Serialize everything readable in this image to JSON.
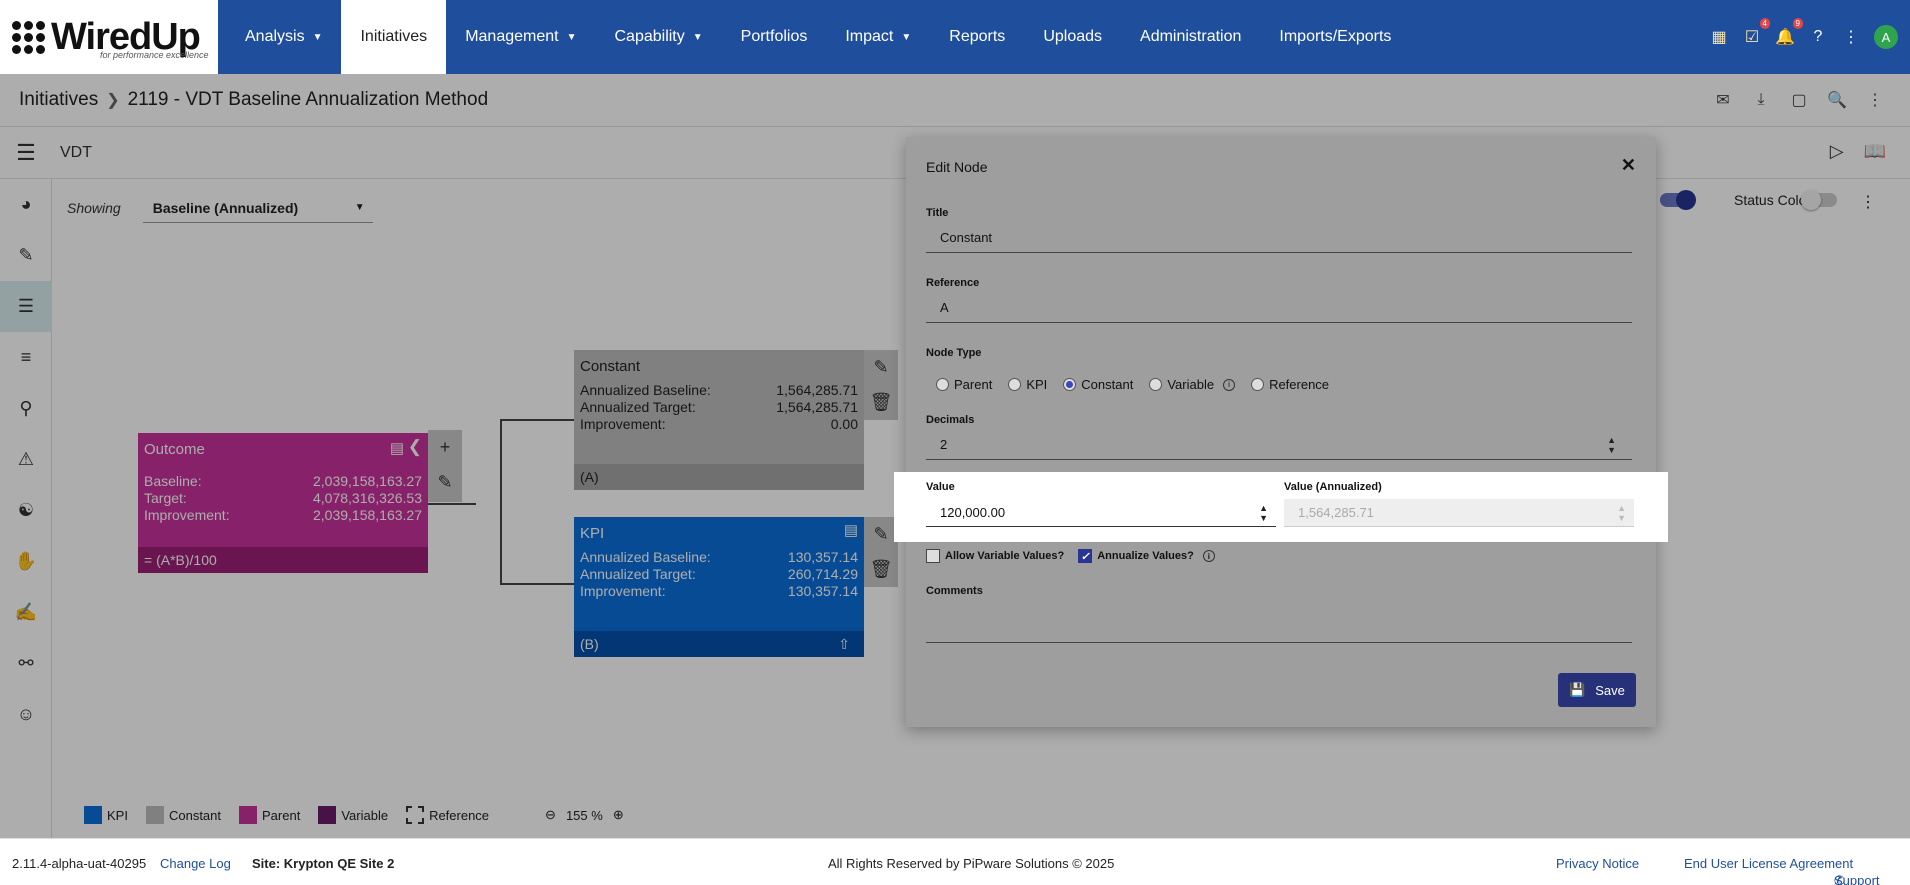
{
  "logo": {
    "name": "WiredUp",
    "tagline": "for performance excellence"
  },
  "nav": {
    "items": [
      {
        "label": "Analysis",
        "caret": true
      },
      {
        "label": "Initiatives",
        "caret": false,
        "active": true
      },
      {
        "label": "Management",
        "caret": true
      },
      {
        "label": "Capability",
        "caret": true
      },
      {
        "label": "Portfolios",
        "caret": false
      },
      {
        "label": "Impact",
        "caret": true
      },
      {
        "label": "Reports",
        "caret": false
      },
      {
        "label": "Uploads",
        "caret": false
      },
      {
        "label": "Administration",
        "caret": false
      },
      {
        "label": "Imports/Exports",
        "caret": false
      }
    ],
    "tasks_badge": "4",
    "notifications_badge": "9",
    "avatar_initial": "A"
  },
  "breadcrumb": {
    "root": "Initiatives",
    "current": "2119 - VDT Baseline Annualization Method"
  },
  "subheader": {
    "title": "VDT"
  },
  "canvas": {
    "showing_label": "Showing",
    "showing_value": "Baseline (Annualized)",
    "status_colors_label": "Status Colors",
    "zoom": "155 %"
  },
  "nodes": {
    "outcome": {
      "title": "Outcome",
      "rows": [
        {
          "label": "Baseline:",
          "value": "2,039,158,163.27"
        },
        {
          "label": "Target:",
          "value": "4,078,316,326.53"
        },
        {
          "label": "Improvement:",
          "value": "2,039,158,163.27"
        }
      ],
      "footer": "= (A*B)/100"
    },
    "constant": {
      "title": "Constant",
      "rows": [
        {
          "label": "Annualized Baseline:",
          "value": "1,564,285.71"
        },
        {
          "label": "Annualized Target:",
          "value": "1,564,285.71"
        },
        {
          "label": "Improvement:",
          "value": "0.00"
        }
      ],
      "footer": "(A)"
    },
    "kpi": {
      "title": "KPI",
      "rows": [
        {
          "label": "Annualized Baseline:",
          "value": "130,357.14"
        },
        {
          "label": "Annualized Target:",
          "value": "260,714.29"
        },
        {
          "label": "Improvement:",
          "value": "130,357.14"
        }
      ],
      "footer": "(B)"
    }
  },
  "legend": {
    "kpi": "KPI",
    "constant": "Constant",
    "parent": "Parent",
    "variable": "Variable",
    "reference": "Reference"
  },
  "colors": {
    "kpi": "#0b6fdc",
    "constant": "#bdbdbd",
    "parent": "#c8329c",
    "variable": "#6a1b6a",
    "nav": "#1f4e9c",
    "save": "#26317a"
  },
  "modal": {
    "title": "Edit Node",
    "title_label": "Title",
    "title_value": "Constant",
    "reference_label": "Reference",
    "reference_value": "A",
    "node_type_label": "Node Type",
    "node_types": [
      "Parent",
      "KPI",
      "Constant",
      "Variable",
      "Reference"
    ],
    "node_type_selected": "Constant",
    "decimals_label": "Decimals",
    "decimals_value": "2",
    "value_label": "Value",
    "value_value": "120,000.00",
    "value_annualized_label": "Value (Annualized)",
    "value_annualized_value": "1,564,285.71",
    "allow_variable_label": "Allow Variable Values?",
    "allow_variable_checked": false,
    "annualize_label": "Annualize Values?",
    "annualize_checked": true,
    "comments_label": "Comments",
    "save_label": "Save"
  },
  "footer": {
    "version": "2.11.4-alpha-uat-40295",
    "changelog": "Change Log",
    "site": "Site: Krypton QE Site 2",
    "copyright": "All Rights Reserved by PiPware Solutions © 2025",
    "privacy": "Privacy Notice",
    "eula": "End User License Agreement",
    "support": "Support"
  }
}
